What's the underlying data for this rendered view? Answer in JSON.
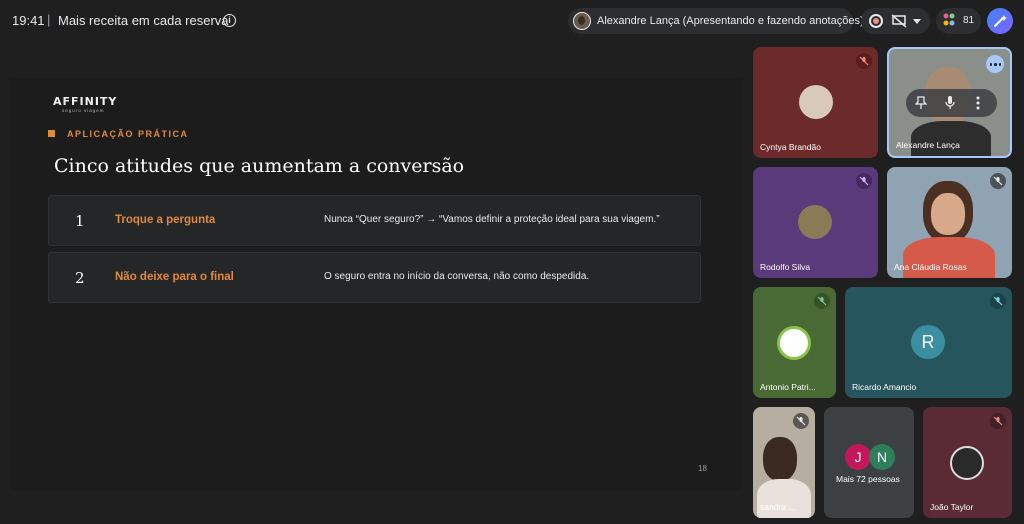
{
  "topbar": {
    "time": "19:41",
    "separator": "|",
    "meeting_title": "Mais receita em cada reserva",
    "info_icon": "info-icon",
    "presenter_text": "Alexandre Lança (Apresentando e fazendo anotações)",
    "participant_count": "81"
  },
  "slide": {
    "logo": "AFFINITY",
    "logo_sub": "seguro viagem",
    "kicker": "APLICAÇÃO PRÁTICA",
    "title": "Cinco atitudes que aumentam a conversão",
    "rows": [
      {
        "num": "1",
        "label": "Troque a pergunta",
        "desc": "Nunca “Quer seguro?” → “Vamos definir a proteção ideal para sua viagem.”"
      },
      {
        "num": "2",
        "label": "Não deixe para o final",
        "desc": "O seguro entra no início da conversa, não como despedida."
      }
    ],
    "page_number": "18"
  },
  "participants": [
    {
      "name": "Cyntya Brandão",
      "muted": true
    },
    {
      "name": "Alexandre Lança",
      "muted": false
    },
    {
      "name": "Rodolfo Silva",
      "muted": true
    },
    {
      "name": "Ana Cláudia Rosas",
      "muted": true
    },
    {
      "name": "Antonio Patri...",
      "muted": true
    },
    {
      "name": "Ricardo Amancio",
      "muted": true,
      "initial": "R"
    },
    {
      "name": "sandra ...",
      "muted": true
    },
    {
      "name": "Mais 72 pessoas",
      "initials": [
        "J",
        "N"
      ]
    },
    {
      "name": "João Taylor",
      "muted": true
    }
  ],
  "colors": {
    "accent_orange": "#e08a3a",
    "background": "#1f1f1f",
    "tile_cyntya": "#6d2a2a",
    "tile_rodolfo": "#5a3a7a",
    "tile_antonio": "#4a6a35",
    "tile_ricardo": "#27555d",
    "tile_more": "#3c4043",
    "tile_joao": "#5a2a35"
  }
}
